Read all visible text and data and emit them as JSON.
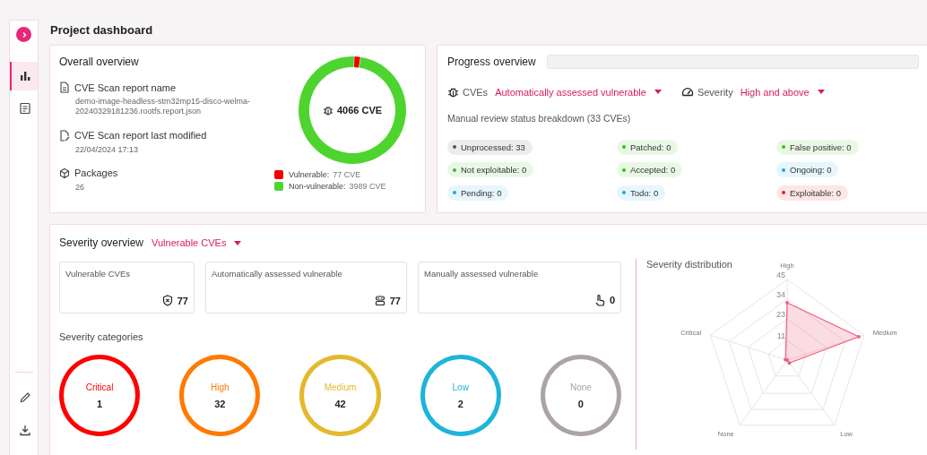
{
  "sidebar": {
    "top_items": [
      {
        "selected": true
      },
      {
        "selected": false
      }
    ]
  },
  "title": "Project dashboard",
  "overall": {
    "title": "Overall overview",
    "fields": [
      {
        "label": "CVE Scan report name",
        "value": "demo-image-headless-stm32mp15-disco-welma-20240329181236.rootfs.report.json"
      },
      {
        "label": "CVE Scan report last modified",
        "value": "22/04/2024 17:13"
      },
      {
        "label": "Packages",
        "value": "26"
      }
    ],
    "total": "4066 CVE",
    "legend": [
      {
        "label": "Vulnerable:",
        "value": "77 CVE",
        "color": "#f00000"
      },
      {
        "label": "Non-vulnerable:",
        "value": "3989 CVE",
        "color": "#4ed42f"
      }
    ]
  },
  "progress": {
    "title": "Progress overview",
    "bar": {
      "level": 0
    },
    "filters": [
      {
        "label": "CVEs",
        "value": "Automatically assessed vulnerable"
      },
      {
        "label": "Severity",
        "value": "High and above"
      }
    ],
    "breakdown_title": "Manual review status breakdown  (33 CVEs)",
    "chips": [
      {
        "label": "Unprocessed: 33",
        "color": "#555555"
      },
      {
        "label": "Patched: 0",
        "color": "#34c116"
      },
      {
        "label": "False positive: 0",
        "color": "#34c116"
      },
      {
        "label": "Not exploitable: 0",
        "color": "#34c116"
      },
      {
        "label": "Accepted: 0",
        "color": "#34c116"
      },
      {
        "label": "Ongoing: 0",
        "color": "#1aa9e0"
      },
      {
        "label": "Pending: 0",
        "color": "#1aa9e0"
      },
      {
        "label": "Todo: 0",
        "color": "#1aa9e0"
      },
      {
        "label": "Exploitable: 0",
        "color": "#f01818"
      }
    ]
  },
  "severity": {
    "title": "Severity overview",
    "filter": "Vulnerable CVEs",
    "stats": [
      {
        "label": "Vulnerable CVEs",
        "value": "77"
      },
      {
        "label": "Automatically assessed vulnerable",
        "value": "77"
      },
      {
        "label": "Manually assessed vulnerable",
        "value": "0"
      }
    ],
    "categories_title": "Severity categories",
    "categories": [
      {
        "label": "Critical",
        "value": "1",
        "color": "#ff0000"
      },
      {
        "label": "High",
        "value": "32",
        "color": "#ff7a00"
      },
      {
        "label": "Medium",
        "value": "42",
        "color": "#e3b92c"
      },
      {
        "label": "Low",
        "value": "2",
        "color": "#1eb4da"
      },
      {
        "label": "None",
        "value": "0",
        "color": "#aba3a6"
      }
    ],
    "distribution": {
      "title": "Severity distribution",
      "chart_data": {
        "type": "radar",
        "categories": [
          "High",
          "Medium",
          "Low",
          "None",
          "Critical"
        ],
        "series": [
          {
            "color": "#f0607f",
            "values": [
              32,
              42,
              2,
              0,
              1
            ]
          }
        ],
        "ylim": [
          0,
          45
        ],
        "yticks": [
          11,
          23,
          34,
          45
        ]
      }
    }
  }
}
